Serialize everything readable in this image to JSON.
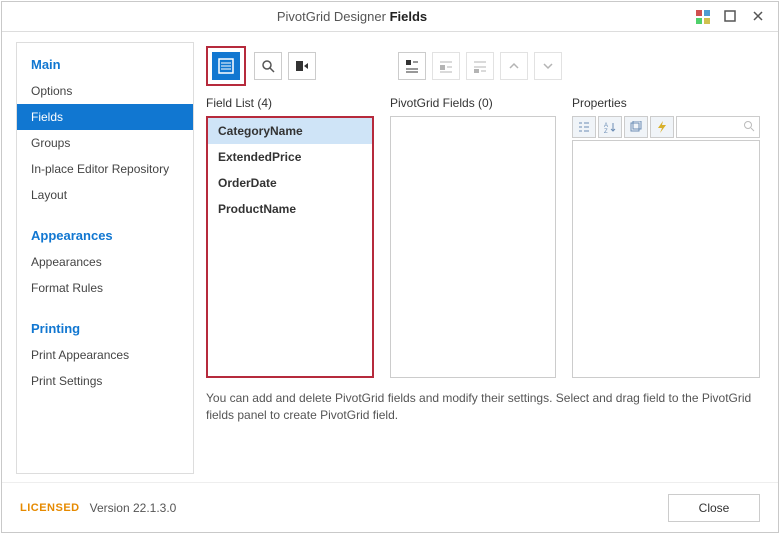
{
  "header": {
    "titlePrefix": "PivotGrid Designer",
    "titleBold": "Fields"
  },
  "sidebar": {
    "sections": [
      {
        "title": "Main",
        "items": [
          "Options",
          "Fields",
          "Groups",
          "In-place Editor Repository",
          "Layout"
        ]
      },
      {
        "title": "Appearances",
        "items": [
          "Appearances",
          "Format Rules"
        ]
      },
      {
        "title": "Printing",
        "items": [
          "Print Appearances",
          "Print Settings"
        ]
      }
    ],
    "active": "Fields"
  },
  "panels": {
    "fieldList": {
      "label": "Field List (4)",
      "items": [
        "CategoryName",
        "ExtendedPrice",
        "OrderDate",
        "ProductName"
      ],
      "selected": "CategoryName"
    },
    "pivotGridFields": {
      "label": "PivotGrid Fields (0)",
      "items": []
    },
    "properties": {
      "label": "Properties"
    }
  },
  "hint": "You can add and delete PivotGrid fields and modify their settings. Select and drag field to the PivotGrid fields panel to create PivotGrid field.",
  "footer": {
    "license": "LICENSED",
    "version": "Version 22.1.3.0",
    "close": "Close"
  },
  "colors": {
    "accent": "#1177d1",
    "highlight": "#b62a3c",
    "selection": "#cfe4f7",
    "license": "#e68a00"
  }
}
